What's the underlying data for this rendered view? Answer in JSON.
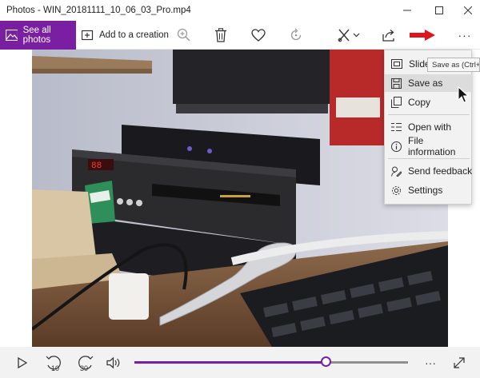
{
  "window": {
    "title": "Photos - WIN_20181111_10_06_03_Pro.mp4"
  },
  "toolbar": {
    "see_all_label": "See all photos",
    "add_to_creation_label": "Add to a creation",
    "more_label": "···"
  },
  "context_menu": {
    "items": [
      {
        "label": "Slideshow",
        "icon": "slideshow-icon"
      },
      {
        "label": "Save as",
        "icon": "save-icon",
        "highlighted": true
      },
      {
        "label": "Copy",
        "icon": "copy-icon"
      },
      {
        "label": "Open with",
        "icon": "open-with-icon"
      },
      {
        "label": "File information",
        "icon": "info-icon"
      },
      {
        "label": "Send feedback",
        "icon": "feedback-icon"
      },
      {
        "label": "Settings",
        "icon": "gear-icon"
      }
    ]
  },
  "tooltip": {
    "text": "Save as (Ctrl+S)"
  },
  "playback": {
    "rewind_label": "10",
    "forward_label": "30",
    "progress": 0.7,
    "more_label": "···"
  },
  "colors": {
    "accent": "#7a1fa2",
    "annotation_arrow": "#e0151b"
  }
}
